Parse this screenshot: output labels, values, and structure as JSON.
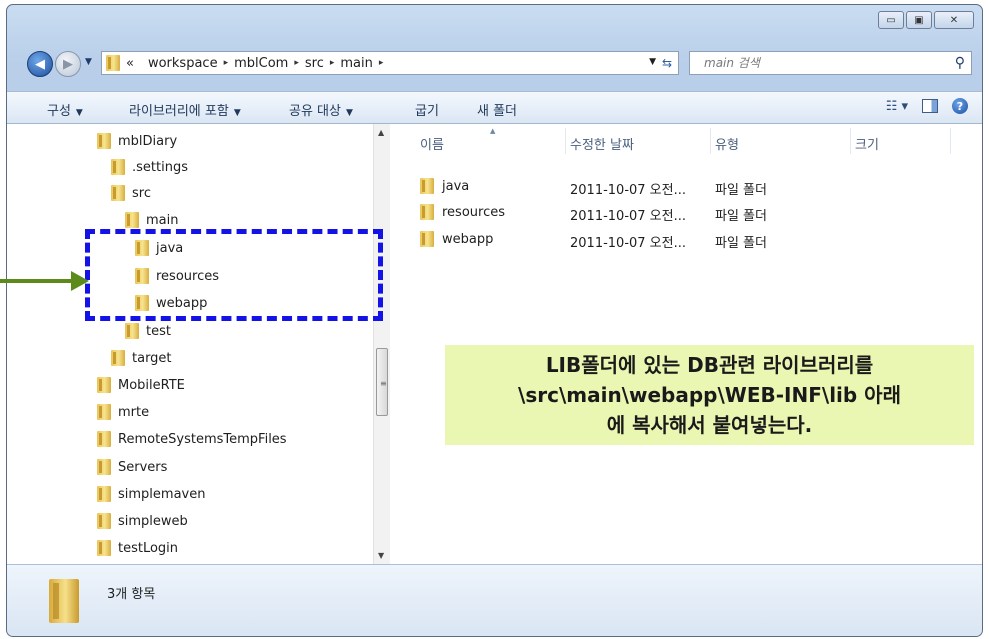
{
  "window": {
    "caption": {
      "minimize": "▭",
      "maximize": "▣",
      "close": "✕"
    }
  },
  "nav": {
    "back": "◀",
    "forward": "▶",
    "address": {
      "overflow": "«",
      "crumbs": [
        "workspace",
        "mblCom",
        "src",
        "main"
      ],
      "separator": "▸"
    },
    "search_placeholder": "main 검색"
  },
  "toolbar": {
    "organize": "구성",
    "include_library": "라이브러리에 포함",
    "share_with": "공유 대상",
    "burn": "굽기",
    "new_folder": "새 폴더"
  },
  "tree": {
    "items": [
      {
        "label": "mblDiary",
        "indent": 2
      },
      {
        "label": ".settings",
        "indent": 3
      },
      {
        "label": "src",
        "indent": 3
      },
      {
        "label": "main",
        "indent": 4
      },
      {
        "label": "java",
        "indent": 5
      },
      {
        "label": "resources",
        "indent": 5
      },
      {
        "label": "webapp",
        "indent": 5
      },
      {
        "label": "test",
        "indent": 4
      },
      {
        "label": "target",
        "indent": 3
      },
      {
        "label": "MobileRTE",
        "indent": 2
      },
      {
        "label": "mrte",
        "indent": 2
      },
      {
        "label": "RemoteSystemsTempFiles",
        "indent": 2
      },
      {
        "label": "Servers",
        "indent": 2
      },
      {
        "label": "simplemaven",
        "indent": 2
      },
      {
        "label": "simpleweb",
        "indent": 2
      },
      {
        "label": "testLogin",
        "indent": 2
      }
    ]
  },
  "columns": {
    "name": "이름",
    "modified": "수정한 날짜",
    "type": "유형",
    "size": "크기"
  },
  "files": [
    {
      "name": "java",
      "modified": "2011-10-07 오전...",
      "type": "파일 폴더"
    },
    {
      "name": "resources",
      "modified": "2011-10-07 오전...",
      "type": "파일 폴더"
    },
    {
      "name": "webapp",
      "modified": "2011-10-07 오전...",
      "type": "파일 폴더"
    }
  ],
  "status": {
    "item_count": "3개 항목"
  },
  "annotation": {
    "lines": [
      "LIB폴더에 있는 DB관련 라이브러리를",
      "\\src\\main\\webapp\\WEB-INF\\lib 아래",
      "에 복사해서 붙여넣는다."
    ],
    "note_color": "#eaf7b2",
    "box_color": "#1313e8",
    "arrow_color": "#5c8b1c"
  }
}
